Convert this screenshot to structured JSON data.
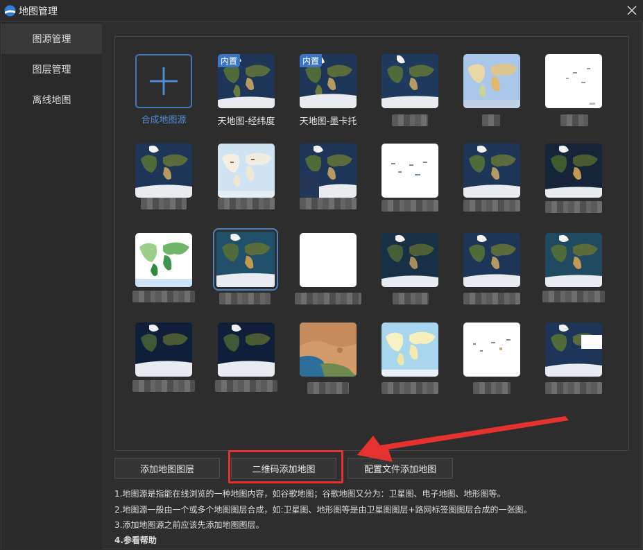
{
  "window": {
    "title": "地图管理"
  },
  "sidebar": {
    "items": [
      {
        "label": "图源管理",
        "active": true
      },
      {
        "label": "图层管理",
        "active": false
      },
      {
        "label": "离线地图",
        "active": false
      }
    ]
  },
  "tiles": {
    "add_label": "合成地图源",
    "badge": "内置",
    "labels": [
      "天地图-经纬度",
      "天地图-墨卡托"
    ]
  },
  "buttons": {
    "add_layer": "添加地图图层",
    "qr_add": "二维码添加地图",
    "config_add": "配置文件添加地图"
  },
  "help": {
    "line1": "1.地图源是指能在线浏览的一种地图内容，如谷歌地图；谷歌地图又分为：卫星图、电子地图、地形图等。",
    "line2": "2.地图源一般由一个或多个地图图层合成，如:卫星图、地形图等是由卫星图图层+路网标签图图层合成的一张图。",
    "line3": "3.添加地图源之前应该先添加地图图层。",
    "line4": "4.参看帮助"
  },
  "colors": {
    "accent": "#4f8bd6",
    "highlight": "#e5322e"
  }
}
